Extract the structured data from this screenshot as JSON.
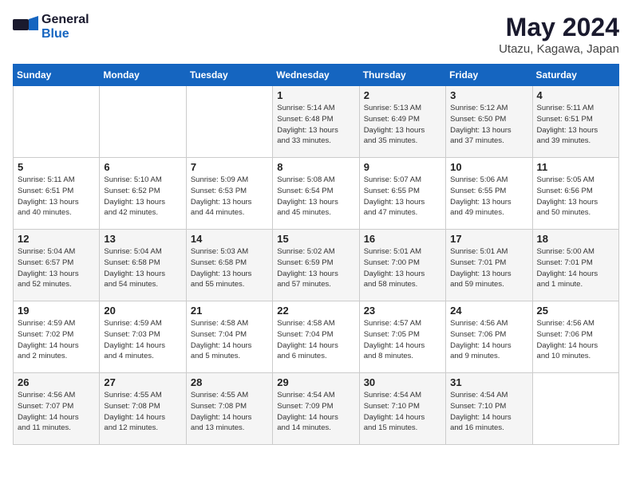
{
  "logo": {
    "text_general": "General",
    "text_blue": "Blue"
  },
  "title": {
    "month_year": "May 2024",
    "location": "Utazu, Kagawa, Japan"
  },
  "weekdays": [
    "Sunday",
    "Monday",
    "Tuesday",
    "Wednesday",
    "Thursday",
    "Friday",
    "Saturday"
  ],
  "weeks": [
    [
      {
        "day": "",
        "info": ""
      },
      {
        "day": "",
        "info": ""
      },
      {
        "day": "",
        "info": ""
      },
      {
        "day": "1",
        "info": "Sunrise: 5:14 AM\nSunset: 6:48 PM\nDaylight: 13 hours\nand 33 minutes."
      },
      {
        "day": "2",
        "info": "Sunrise: 5:13 AM\nSunset: 6:49 PM\nDaylight: 13 hours\nand 35 minutes."
      },
      {
        "day": "3",
        "info": "Sunrise: 5:12 AM\nSunset: 6:50 PM\nDaylight: 13 hours\nand 37 minutes."
      },
      {
        "day": "4",
        "info": "Sunrise: 5:11 AM\nSunset: 6:51 PM\nDaylight: 13 hours\nand 39 minutes."
      }
    ],
    [
      {
        "day": "5",
        "info": "Sunrise: 5:11 AM\nSunset: 6:51 PM\nDaylight: 13 hours\nand 40 minutes."
      },
      {
        "day": "6",
        "info": "Sunrise: 5:10 AM\nSunset: 6:52 PM\nDaylight: 13 hours\nand 42 minutes."
      },
      {
        "day": "7",
        "info": "Sunrise: 5:09 AM\nSunset: 6:53 PM\nDaylight: 13 hours\nand 44 minutes."
      },
      {
        "day": "8",
        "info": "Sunrise: 5:08 AM\nSunset: 6:54 PM\nDaylight: 13 hours\nand 45 minutes."
      },
      {
        "day": "9",
        "info": "Sunrise: 5:07 AM\nSunset: 6:55 PM\nDaylight: 13 hours\nand 47 minutes."
      },
      {
        "day": "10",
        "info": "Sunrise: 5:06 AM\nSunset: 6:55 PM\nDaylight: 13 hours\nand 49 minutes."
      },
      {
        "day": "11",
        "info": "Sunrise: 5:05 AM\nSunset: 6:56 PM\nDaylight: 13 hours\nand 50 minutes."
      }
    ],
    [
      {
        "day": "12",
        "info": "Sunrise: 5:04 AM\nSunset: 6:57 PM\nDaylight: 13 hours\nand 52 minutes."
      },
      {
        "day": "13",
        "info": "Sunrise: 5:04 AM\nSunset: 6:58 PM\nDaylight: 13 hours\nand 54 minutes."
      },
      {
        "day": "14",
        "info": "Sunrise: 5:03 AM\nSunset: 6:58 PM\nDaylight: 13 hours\nand 55 minutes."
      },
      {
        "day": "15",
        "info": "Sunrise: 5:02 AM\nSunset: 6:59 PM\nDaylight: 13 hours\nand 57 minutes."
      },
      {
        "day": "16",
        "info": "Sunrise: 5:01 AM\nSunset: 7:00 PM\nDaylight: 13 hours\nand 58 minutes."
      },
      {
        "day": "17",
        "info": "Sunrise: 5:01 AM\nSunset: 7:01 PM\nDaylight: 13 hours\nand 59 minutes."
      },
      {
        "day": "18",
        "info": "Sunrise: 5:00 AM\nSunset: 7:01 PM\nDaylight: 14 hours\nand 1 minute."
      }
    ],
    [
      {
        "day": "19",
        "info": "Sunrise: 4:59 AM\nSunset: 7:02 PM\nDaylight: 14 hours\nand 2 minutes."
      },
      {
        "day": "20",
        "info": "Sunrise: 4:59 AM\nSunset: 7:03 PM\nDaylight: 14 hours\nand 4 minutes."
      },
      {
        "day": "21",
        "info": "Sunrise: 4:58 AM\nSunset: 7:04 PM\nDaylight: 14 hours\nand 5 minutes."
      },
      {
        "day": "22",
        "info": "Sunrise: 4:58 AM\nSunset: 7:04 PM\nDaylight: 14 hours\nand 6 minutes."
      },
      {
        "day": "23",
        "info": "Sunrise: 4:57 AM\nSunset: 7:05 PM\nDaylight: 14 hours\nand 8 minutes."
      },
      {
        "day": "24",
        "info": "Sunrise: 4:56 AM\nSunset: 7:06 PM\nDaylight: 14 hours\nand 9 minutes."
      },
      {
        "day": "25",
        "info": "Sunrise: 4:56 AM\nSunset: 7:06 PM\nDaylight: 14 hours\nand 10 minutes."
      }
    ],
    [
      {
        "day": "26",
        "info": "Sunrise: 4:56 AM\nSunset: 7:07 PM\nDaylight: 14 hours\nand 11 minutes."
      },
      {
        "day": "27",
        "info": "Sunrise: 4:55 AM\nSunset: 7:08 PM\nDaylight: 14 hours\nand 12 minutes."
      },
      {
        "day": "28",
        "info": "Sunrise: 4:55 AM\nSunset: 7:08 PM\nDaylight: 14 hours\nand 13 minutes."
      },
      {
        "day": "29",
        "info": "Sunrise: 4:54 AM\nSunset: 7:09 PM\nDaylight: 14 hours\nand 14 minutes."
      },
      {
        "day": "30",
        "info": "Sunrise: 4:54 AM\nSunset: 7:10 PM\nDaylight: 14 hours\nand 15 minutes."
      },
      {
        "day": "31",
        "info": "Sunrise: 4:54 AM\nSunset: 7:10 PM\nDaylight: 14 hours\nand 16 minutes."
      },
      {
        "day": "",
        "info": ""
      }
    ]
  ]
}
